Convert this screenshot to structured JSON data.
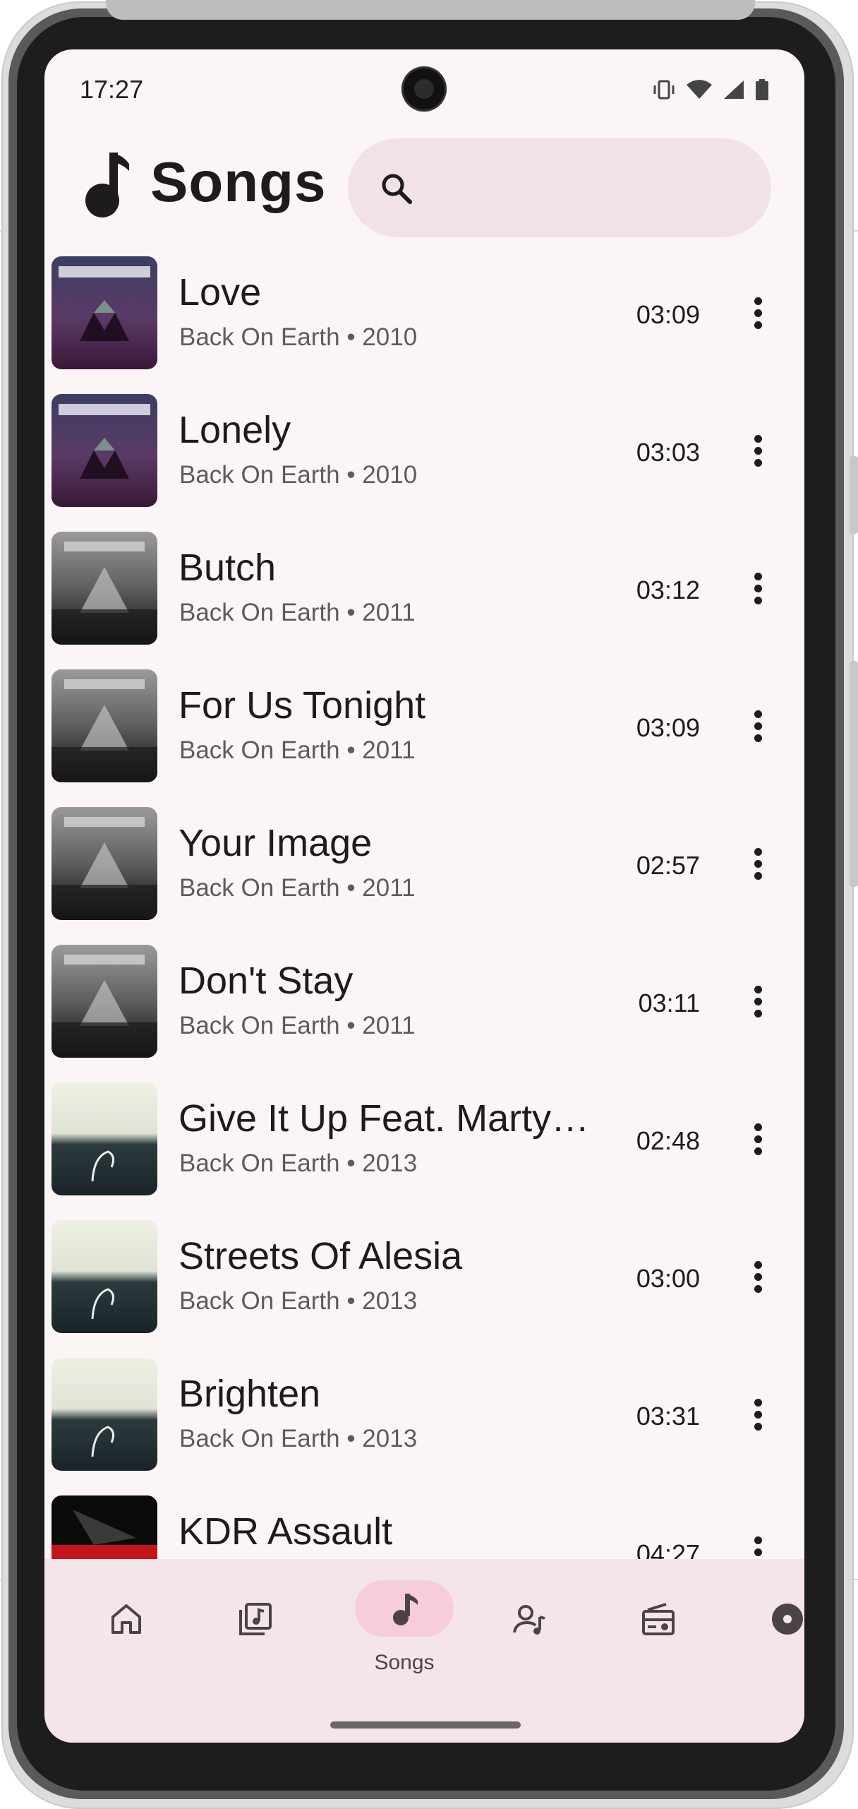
{
  "status_bar": {
    "time": "17:27"
  },
  "header": {
    "title": "Songs",
    "search_placeholder": ""
  },
  "songs": [
    {
      "title": "Love",
      "subtitle": "Back On Earth • 2010",
      "duration": "03:09",
      "art": "purple"
    },
    {
      "title": "Lonely",
      "subtitle": "Back On Earth • 2010",
      "duration": "03:03",
      "art": "purple"
    },
    {
      "title": "Butch",
      "subtitle": "Back On Earth • 2011",
      "duration": "03:12",
      "art": "grey"
    },
    {
      "title": "For Us Tonight",
      "subtitle": "Back On Earth • 2011",
      "duration": "03:09",
      "art": "grey"
    },
    {
      "title": "Your Image",
      "subtitle": "Back On Earth • 2011",
      "duration": "02:57",
      "art": "grey"
    },
    {
      "title": "Don't Stay",
      "subtitle": "Back On Earth • 2011",
      "duration": "03:11",
      "art": "grey"
    },
    {
      "title": "Give It Up Feat. Marty…",
      "subtitle": "Back On Earth • 2013",
      "duration": "02:48",
      "art": "teal"
    },
    {
      "title": "Streets Of Alesia",
      "subtitle": "Back On Earth • 2013",
      "duration": "03:00",
      "art": "teal"
    },
    {
      "title": "Brighten",
      "subtitle": "Back On Earth • 2013",
      "duration": "03:31",
      "art": "teal"
    },
    {
      "title": "KDR Assault",
      "subtitle": "",
      "duration": "04:27",
      "art": "red"
    }
  ],
  "nav": {
    "items": [
      {
        "icon": "home-icon",
        "label": ""
      },
      {
        "icon": "albums-icon",
        "label": ""
      },
      {
        "icon": "songs-icon",
        "label": "Songs",
        "active": true
      },
      {
        "icon": "artists-icon",
        "label": ""
      },
      {
        "icon": "radio-icon",
        "label": ""
      },
      {
        "icon": "disc-icon",
        "label": ""
      }
    ]
  },
  "colors": {
    "background": "#fcf5f5",
    "search_bg": "#f1e3e5",
    "nav_bg": "#f4e5ea",
    "nav_active_pill": "#f7cddc"
  }
}
